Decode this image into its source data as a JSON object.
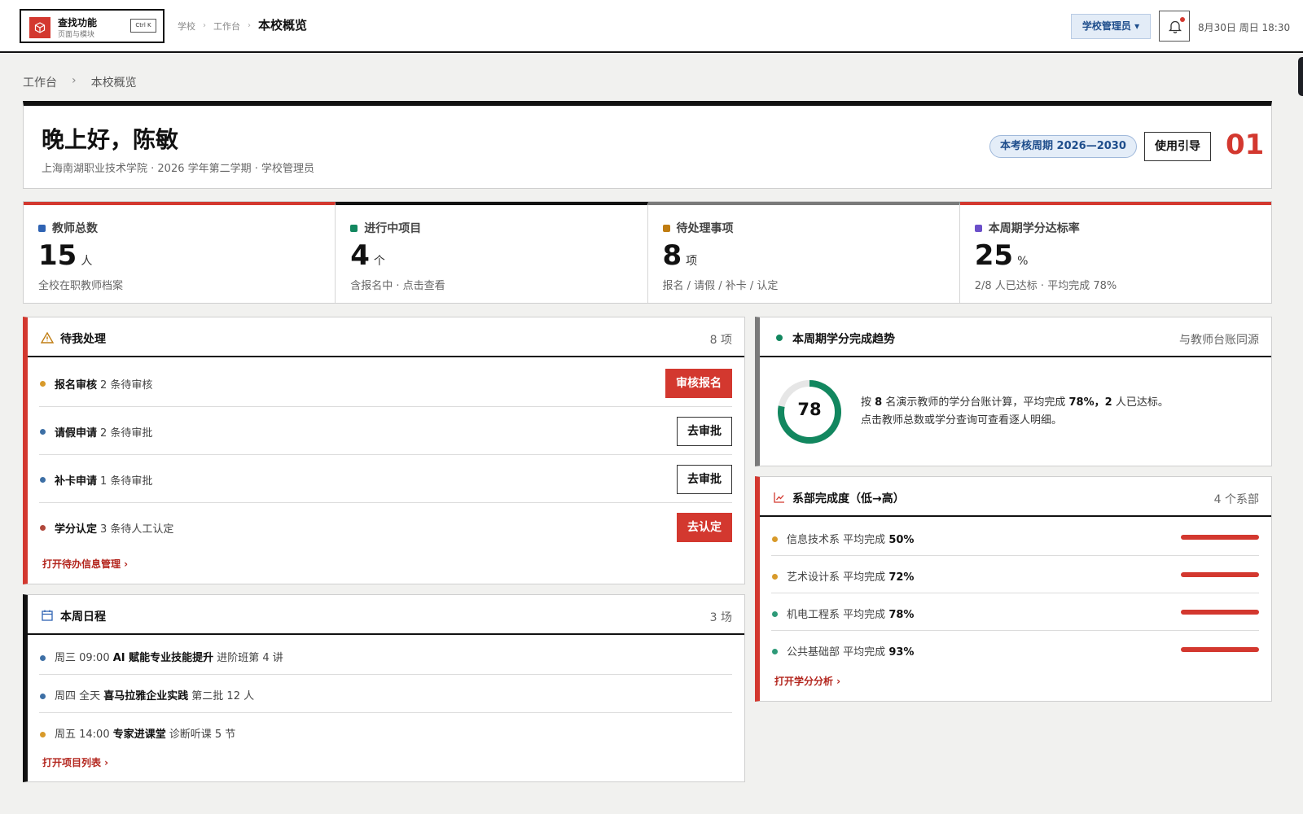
{
  "topbar": {
    "search_title": "查找功能",
    "search_sub": "页面与模块",
    "shortcut": "Ctrl K",
    "crumbs": [
      "学校",
      "工作台"
    ],
    "crumb_sep": "›",
    "current": "本校概览",
    "role": "学校管理员",
    "role_caret": "▾",
    "datetime": "8月30日 周日 18:30"
  },
  "breadcrumb": {
    "items": [
      "工作台",
      "本校概览"
    ],
    "sep": "›"
  },
  "greeting": {
    "title": "晚上好，陈敏",
    "subtitle": "上海南湖职业技术学院 · 2026 学年第二学期 · 学校管理员",
    "cycle": "本考核周期 2026—2030",
    "guide": "使用引导",
    "number": "01"
  },
  "stats": [
    {
      "label": "教师总数",
      "value": "15",
      "unit": "人",
      "desc": "全校在职教师档案",
      "dot_color": "#2f63b3",
      "top_color": "#d3382f"
    },
    {
      "label": "进行中项目",
      "value": "4",
      "unit": "个",
      "desc": "含报名中 · 点击查看",
      "dot_color": "#12875f",
      "top_color": "#111111"
    },
    {
      "label": "待处理事项",
      "value": "8",
      "unit": "项",
      "desc": "报名 / 请假 / 补卡 / 认定",
      "dot_color": "#c07d12",
      "top_color": "#7a7a7a"
    },
    {
      "label": "本周期学分达标率",
      "value": "25",
      "unit": "%",
      "desc": "2/8 人已达标 · 平均完成 78%",
      "dot_color": "#6b4fc9",
      "top_color": "#d3382f"
    }
  ],
  "todo": {
    "title": "待我处理",
    "count": "8 项",
    "rows": [
      {
        "name": "报名审核",
        "detail": "2 条待审核",
        "action": "审核报名",
        "style": "red",
        "bullet": "#d89a2a"
      },
      {
        "name": "请假申请",
        "detail": "2 条待审批",
        "action": "去审批",
        "style": "outline",
        "bullet": "#3d6fa5"
      },
      {
        "name": "补卡申请",
        "detail": "1 条待审批",
        "action": "去审批",
        "style": "outline",
        "bullet": "#3d6fa5"
      },
      {
        "name": "学分认定",
        "detail": "3 条待人工认定",
        "action": "去认定",
        "style": "red",
        "bullet": "#b0473a"
      }
    ],
    "link": "打开待办信息管理 ›"
  },
  "schedule": {
    "title": "本周日程",
    "count": "3 场",
    "rows": [
      {
        "time": "周三 09:00",
        "name": "AI 赋能专业技能提升",
        "detail": "进阶班第 4 讲",
        "bullet": "#3d6fa5"
      },
      {
        "time": "周四 全天",
        "name": "喜马拉雅企业实践",
        "detail": "第二批 12 人",
        "bullet": "#3d6fa5"
      },
      {
        "time": "周五 14:00",
        "name": "专家进课堂",
        "detail": "诊断听课 5 节",
        "bullet": "#d89a2a"
      }
    ],
    "link": "打开项目列表 ›"
  },
  "trend": {
    "title": "本周期学分完成趋势",
    "note": "与教师台账同源",
    "percent": 78,
    "percent_label": "78",
    "line1": {
      "p1": "按",
      "n1": "8",
      "p2": "名演示教师的学分台账计算，平均完成",
      "n2": "78%，",
      "n3": "2",
      "p3": "人已达标。"
    },
    "line2": "点击教师总数或学分查询可查看逐人明细。"
  },
  "departments": {
    "title": "系部完成度（低→高）",
    "count": "4 个系部",
    "prefix": "平均完成",
    "rows": [
      {
        "name": "信息技术系",
        "value": "50%",
        "bullet": "#d89a2a"
      },
      {
        "name": "艺术设计系",
        "value": "72%",
        "bullet": "#d89a2a"
      },
      {
        "name": "机电工程系",
        "value": "78%",
        "bullet": "#2e9a78"
      },
      {
        "name": "公共基础部",
        "value": "93%",
        "bullet": "#2e9a78"
      }
    ],
    "link": "打开学分分析 ›"
  },
  "colors": {
    "accent_red": "#d3382f",
    "brand_blue": "#1f4e8c",
    "green": "#12875f"
  },
  "icons": [
    "cube-icon",
    "bell-icon",
    "warning-icon",
    "calendar-icon",
    "chart-icon",
    "status-dot-icon"
  ]
}
